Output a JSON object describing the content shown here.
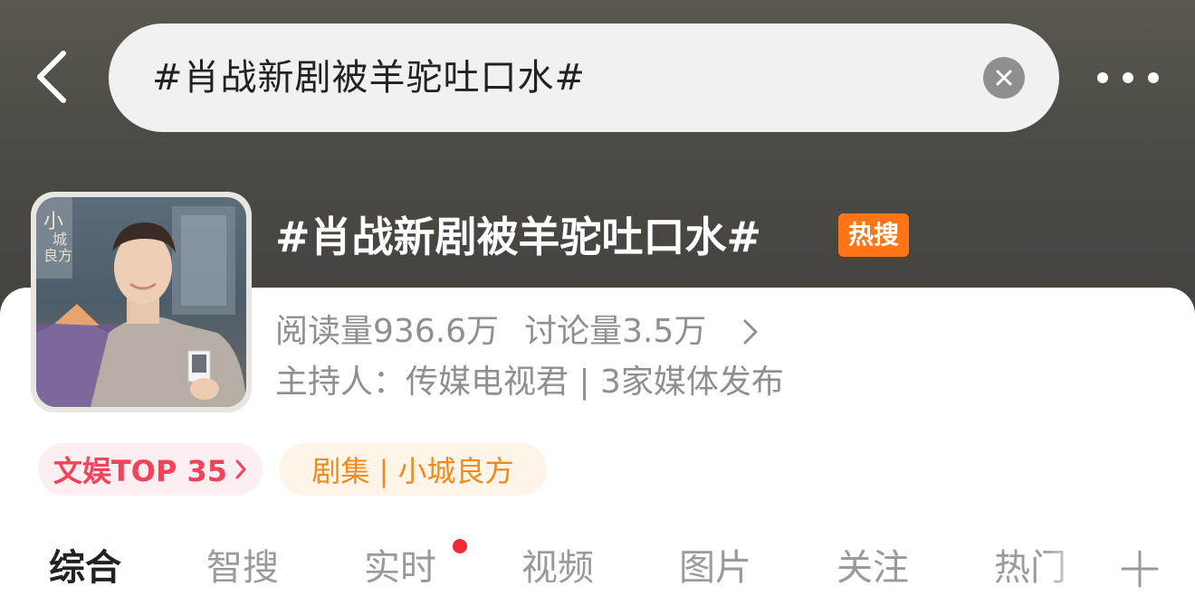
{
  "search": {
    "query": "#肖战新剧被羊驼吐口水#"
  },
  "icons": {
    "back": "back-chevron-icon",
    "clear": "clear-x-icon",
    "more": "more-dots-icon",
    "stats_chevron": "chevron-right-icon",
    "rank_arrow": "chevron-right-icon",
    "add_tab": "plus-icon"
  },
  "topic": {
    "title": "#肖战新剧被羊驼吐口水#",
    "badge": "热搜",
    "reads_label": "阅读量",
    "reads_value": "936.6万",
    "discuss_label": "讨论量",
    "discuss_value": "3.5万",
    "host_line": "主持人：传媒电视君 | 3家媒体发布"
  },
  "tags": {
    "rank": "文娱TOP 35",
    "drama": "剧集 | 小城良方"
  },
  "tabs": [
    {
      "label": "综合",
      "active": true
    },
    {
      "label": "智搜"
    },
    {
      "label": "实时"
    },
    {
      "label": "视频"
    },
    {
      "label": "图片"
    },
    {
      "label": "关注"
    },
    {
      "label": "热门"
    }
  ],
  "colors": {
    "hot_badge": "#ff7414",
    "rank_text": "#f2435b",
    "rank_bg": "#fdeef1",
    "drama_text": "#f08a1c",
    "drama_bg": "#fff4e8",
    "notification_dot": "#ee2a36"
  }
}
